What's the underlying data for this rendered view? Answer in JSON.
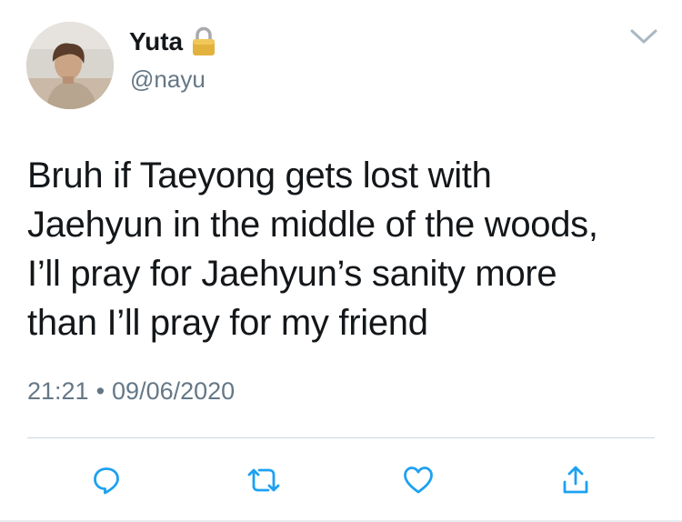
{
  "user": {
    "display_name": "Yuta",
    "handle": "@nayu",
    "avatar_icon": "profile-photo",
    "protected_icon": "lock-icon"
  },
  "tweet": {
    "text_lines": [
      "Bruh if Taeyong gets lost with",
      "Jaehyun in the middle of the woods,",
      "I’ll pray for Jaehyun’s sanity more",
      "than I’ll pray for my friend"
    ],
    "time": "21:21",
    "separator": "•",
    "date": "09/06/2020"
  },
  "actions": {
    "reply_icon": "reply-icon",
    "retweet_icon": "retweet-icon",
    "like_icon": "heart-icon",
    "share_icon": "share-icon",
    "menu_icon": "chevron-down-icon"
  },
  "colors": {
    "text": "#14171a",
    "secondary": "#657786",
    "icon": "#1da1f2",
    "divider": "#ccd6dd"
  }
}
